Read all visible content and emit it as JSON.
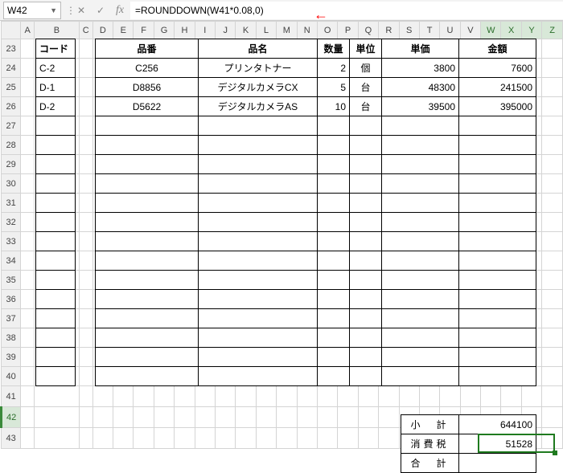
{
  "name_box": "W42",
  "formula": "=ROUNDDOWN(W41*0.08,0)",
  "col_headers": [
    "A",
    "B",
    "C",
    "D",
    "E",
    "F",
    "G",
    "H",
    "I",
    "J",
    "K",
    "L",
    "M",
    "N",
    "O",
    "P",
    "Q",
    "R",
    "S",
    "T",
    "U",
    "V",
    "W",
    "X",
    "Y",
    "Z"
  ],
  "row_start": 23,
  "row_end": 43,
  "selected_cols": [
    "W",
    "X",
    "Y",
    "Z"
  ],
  "selected_row": 42,
  "table": {
    "code_header": "コード",
    "headers": {
      "hinban": "品番",
      "hinmei": "品名",
      "suuryo": "数量",
      "tani": "単位",
      "tanka": "単価",
      "kingaku": "金額"
    },
    "rows": [
      {
        "code": "C-2",
        "hinban": "C256",
        "hinmei": "プリンタトナー",
        "qty": "2",
        "unit": "個",
        "price": "3800",
        "amount": "7600"
      },
      {
        "code": "D-1",
        "hinban": "D8856",
        "hinmei": "デジタルカメラCX",
        "qty": "5",
        "unit": "台",
        "price": "48300",
        "amount": "241500"
      },
      {
        "code": "D-2",
        "hinban": "D5622",
        "hinmei": "デジタルカメラAS",
        "qty": "10",
        "unit": "台",
        "price": "39500",
        "amount": "395000"
      }
    ],
    "blank_rows": 14
  },
  "totals": {
    "subtotal_label": "小　計",
    "subtotal_value": "644100",
    "tax_label": "消費税",
    "tax_value": "51528",
    "total_label": "合　計",
    "total_value": ""
  },
  "icons": {
    "dropdown": "▼",
    "cancel": "✕",
    "enter": "✓",
    "fx": "fx",
    "arrow": "←"
  }
}
